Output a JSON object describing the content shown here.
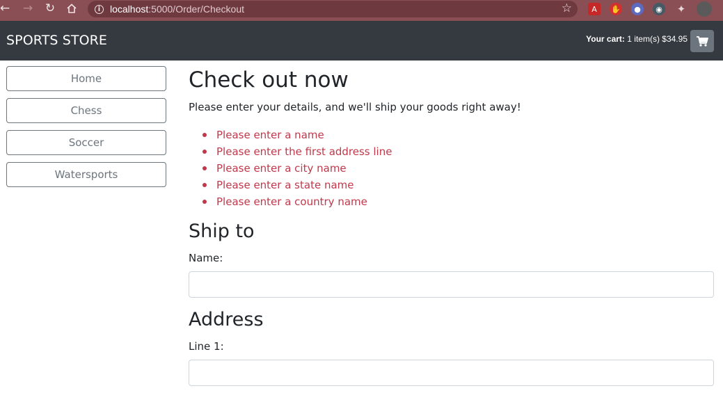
{
  "browser": {
    "url_host": "localhost",
    "url_path": ":5000/Order/Checkout",
    "back_icon": "back-arrow-icon",
    "forward_icon": "forward-arrow-icon",
    "reload_icon": "reload-icon",
    "home_icon": "home-icon",
    "bookmark_icon": "star-icon",
    "chrome_color": "#8a4f55"
  },
  "navbar": {
    "brand": "SPORTS STORE",
    "cart_label": "Your cart:",
    "cart_summary": "1 item(s) $34.95",
    "cart_icon": "shopping-cart-icon",
    "background": "#343a40"
  },
  "sidebar": {
    "categories": [
      {
        "label": "Home"
      },
      {
        "label": "Chess"
      },
      {
        "label": "Soccer"
      },
      {
        "label": "Watersports"
      }
    ]
  },
  "main": {
    "title": "Check out now",
    "intro": "Please enter your details, and we'll ship your goods right away!",
    "errors": [
      "Please enter a name",
      "Please enter the first address line",
      "Please enter a city name",
      "Please enter a state name",
      "Please enter a country name"
    ],
    "error_color": "#c0394a",
    "ship_to_heading": "Ship to",
    "name_label": "Name:",
    "name_value": "",
    "address_heading": "Address",
    "line1_label": "Line 1:",
    "line1_value": ""
  }
}
